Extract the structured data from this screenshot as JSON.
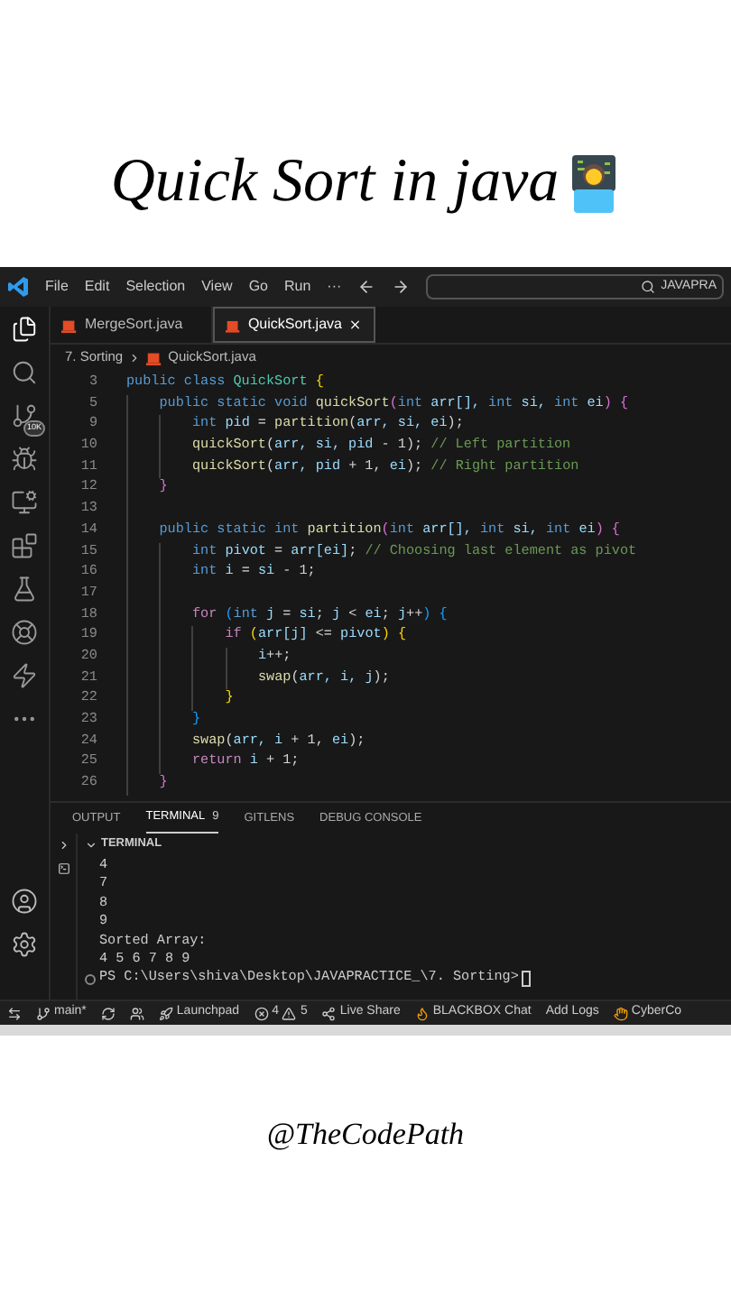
{
  "post": {
    "title": "Quick Sort in java",
    "credit": "@TheCodePath"
  },
  "window": {
    "menu": [
      "File",
      "Edit",
      "Selection",
      "View",
      "Go",
      "Run",
      "···"
    ],
    "search": "JAVAPRA"
  },
  "activity_bar": [
    {
      "kind": "files",
      "selected": true
    },
    {
      "kind": "search",
      "selected": false
    },
    {
      "kind": "source-control",
      "selected": false,
      "badge": "10K"
    },
    {
      "kind": "debug",
      "selected": false
    },
    {
      "kind": "remote",
      "selected": false
    },
    {
      "kind": "extensions",
      "selected": false
    },
    {
      "kind": "testing",
      "selected": false
    },
    {
      "kind": "wheel",
      "selected": false
    },
    {
      "kind": "bolt",
      "selected": false
    },
    {
      "kind": "more",
      "selected": false
    }
  ],
  "activity_bottom": [
    {
      "kind": "account"
    },
    {
      "kind": "settings"
    }
  ],
  "tabs": [
    {
      "label": "MergeSort.java",
      "selected": false
    },
    {
      "label": "QuickSort.java",
      "selected": true
    }
  ],
  "breadcrumb": [
    "7. Sorting",
    "QuickSort.java"
  ],
  "code": [
    {
      "n": "3",
      "tokens": [
        {
          "kind": "kw",
          "text": "public class "
        },
        {
          "kind": "ty",
          "text": "QuickSort"
        },
        {
          "kind": "b1",
          "text": " {"
        }
      ],
      "children": [
        {
          "n": "5",
          "tokens": [
            {
              "kind": "kw",
              "text": "public static void "
            },
            {
              "kind": "fn",
              "text": "quickSort"
            },
            {
              "kind": "b2",
              "text": "("
            },
            {
              "kind": "kw",
              "text": "int "
            },
            {
              "kind": "v",
              "text": "arr[], "
            },
            {
              "kind": "kw",
              "text": "int "
            },
            {
              "kind": "v",
              "text": "si, "
            },
            {
              "kind": "kw",
              "text": "int "
            },
            {
              "kind": "v",
              "text": "ei"
            },
            {
              "kind": "b2",
              "text": ") {"
            }
          ],
          "children": [
            {
              "n": "9",
              "tokens": [
                {
                  "kind": "kw",
                  "text": "int "
                },
                {
                  "kind": "v",
                  "text": "pid"
                },
                {
                  "kind": "p",
                  "text": " = "
                },
                {
                  "kind": "fn",
                  "text": "partition"
                },
                {
                  "kind": "p",
                  "text": "("
                },
                {
                  "kind": "v",
                  "text": "arr, si, ei"
                },
                {
                  "kind": "p",
                  "text": ");"
                }
              ]
            },
            {
              "n": "10",
              "tokens": [
                {
                  "kind": "fn",
                  "text": "quickSort"
                },
                {
                  "kind": "p",
                  "text": "("
                },
                {
                  "kind": "v",
                  "text": "arr, si, pid"
                },
                {
                  "kind": "p",
                  "text": " - 1); "
                },
                {
                  "kind": "cm",
                  "text": "// Left partition"
                }
              ]
            },
            {
              "n": "11",
              "tokens": [
                {
                  "kind": "fn",
                  "text": "quickSort"
                },
                {
                  "kind": "p",
                  "text": "("
                },
                {
                  "kind": "v",
                  "text": "arr, pid"
                },
                {
                  "kind": "p",
                  "text": " + 1, "
                },
                {
                  "kind": "v",
                  "text": "ei"
                },
                {
                  "kind": "p",
                  "text": "); "
                },
                {
                  "kind": "cm",
                  "text": "// Right partition"
                }
              ]
            }
          ]
        },
        {
          "n": "12",
          "tokens": [
            {
              "kind": "b2",
              "text": "}"
            }
          ]
        },
        {
          "n": "13"
        },
        {
          "n": "14",
          "tokens": [
            {
              "kind": "kw",
              "text": "public static int "
            },
            {
              "kind": "fn",
              "text": "partition"
            },
            {
              "kind": "b2",
              "text": "("
            },
            {
              "kind": "kw",
              "text": "int "
            },
            {
              "kind": "v",
              "text": "arr[], "
            },
            {
              "kind": "kw",
              "text": "int "
            },
            {
              "kind": "v",
              "text": "si, "
            },
            {
              "kind": "kw",
              "text": "int "
            },
            {
              "kind": "v",
              "text": "ei"
            },
            {
              "kind": "b2",
              "text": ") {"
            }
          ],
          "children": [
            {
              "n": "15",
              "tokens": [
                {
                  "kind": "kw",
                  "text": "int "
                },
                {
                  "kind": "v",
                  "text": "pivot"
                },
                {
                  "kind": "p",
                  "text": " = "
                },
                {
                  "kind": "v",
                  "text": "arr[ei]"
                },
                {
                  "kind": "p",
                  "text": "; "
                },
                {
                  "kind": "cm",
                  "text": "// Choosing last element as pivot"
                }
              ]
            },
            {
              "n": "16",
              "tokens": [
                {
                  "kind": "kw",
                  "text": "int "
                },
                {
                  "kind": "v",
                  "text": "i"
                },
                {
                  "kind": "p",
                  "text": " = "
                },
                {
                  "kind": "v",
                  "text": "si"
                },
                {
                  "kind": "p",
                  "text": " - 1;"
                }
              ]
            },
            {
              "n": "17"
            },
            {
              "n": "18",
              "tokens": [
                {
                  "kind": "ct",
                  "text": "for "
                },
                {
                  "kind": "b3",
                  "text": "("
                },
                {
                  "kind": "kw",
                  "text": "int "
                },
                {
                  "kind": "v",
                  "text": "j"
                },
                {
                  "kind": "p",
                  "text": " = "
                },
                {
                  "kind": "v",
                  "text": "si"
                },
                {
                  "kind": "p",
                  "text": "; "
                },
                {
                  "kind": "v",
                  "text": "j"
                },
                {
                  "kind": "p",
                  "text": " < "
                },
                {
                  "kind": "v",
                  "text": "ei"
                },
                {
                  "kind": "p",
                  "text": "; "
                },
                {
                  "kind": "v",
                  "text": "j"
                },
                {
                  "kind": "p",
                  "text": "++"
                },
                {
                  "kind": "b3",
                  "text": ") {"
                }
              ],
              "children": [
                {
                  "n": "19",
                  "tokens": [
                    {
                      "kind": "ct",
                      "text": "if "
                    },
                    {
                      "kind": "b1",
                      "text": "("
                    },
                    {
                      "kind": "v",
                      "text": "arr[j]"
                    },
                    {
                      "kind": "p",
                      "text": " <= "
                    },
                    {
                      "kind": "v",
                      "text": "pivot"
                    },
                    {
                      "kind": "b1",
                      "text": ") {"
                    }
                  ],
                  "children": [
                    {
                      "n": "20",
                      "tokens": [
                        {
                          "kind": "v",
                          "text": "i"
                        },
                        {
                          "kind": "p",
                          "text": "++;"
                        }
                      ]
                    },
                    {
                      "n": "21",
                      "tokens": [
                        {
                          "kind": "fn",
                          "text": "swap"
                        },
                        {
                          "kind": "p",
                          "text": "("
                        },
                        {
                          "kind": "v",
                          "text": "arr, i, j"
                        },
                        {
                          "kind": "p",
                          "text": ");"
                        }
                      ]
                    }
                  ]
                },
                {
                  "n": "22",
                  "tokens": [
                    {
                      "kind": "b1",
                      "text": "}"
                    }
                  ]
                }
              ]
            },
            {
              "n": "23",
              "tokens": [
                {
                  "kind": "b3",
                  "text": "}"
                }
              ]
            },
            {
              "n": "24",
              "tokens": [
                {
                  "kind": "fn",
                  "text": "swap"
                },
                {
                  "kind": "p",
                  "text": "("
                },
                {
                  "kind": "v",
                  "text": "arr, i"
                },
                {
                  "kind": "p",
                  "text": " + 1, "
                },
                {
                  "kind": "v",
                  "text": "ei"
                },
                {
                  "kind": "p",
                  "text": ");"
                }
              ]
            },
            {
              "n": "25",
              "tokens": [
                {
                  "kind": "ct",
                  "text": "return "
                },
                {
                  "kind": "v",
                  "text": "i"
                },
                {
                  "kind": "p",
                  "text": " + 1;"
                }
              ]
            }
          ]
        },
        {
          "n": "26",
          "tokens": [
            {
              "kind": "b2",
              "text": "}"
            }
          ]
        }
      ]
    }
  ],
  "panel_tabs": [
    {
      "label": "OUTPUT",
      "selected": false
    },
    {
      "label": "TERMINAL",
      "selected": true,
      "badge": "9"
    },
    {
      "label": "GITLENS",
      "selected": false
    },
    {
      "label": "DEBUG CONSOLE",
      "selected": false
    }
  ],
  "terminal": {
    "header": "TERMINAL",
    "lines": [
      "4",
      "7",
      "8",
      "9",
      "Sorted Array:",
      "4 5 6 7 8 9"
    ],
    "prompt": "PS C:\\Users\\shiva\\Desktop\\JAVAPRACTICE_\\7. Sorting>"
  },
  "status_bar": [
    {
      "kind": "remote"
    },
    {
      "kind": "branch",
      "label": "main*"
    },
    {
      "kind": "sync"
    },
    {
      "kind": "people"
    },
    {
      "kind": "rocket",
      "label": "Launchpad"
    },
    {
      "kind": "problems",
      "errors": "4",
      "warnings": "5"
    },
    {
      "kind": "share",
      "label": "Live Share"
    },
    {
      "kind": "blackbox",
      "label": "BLACKBOX Chat"
    },
    {
      "kind": "text",
      "label": "Add Logs"
    },
    {
      "kind": "hand",
      "label": "CyberCo"
    }
  ]
}
